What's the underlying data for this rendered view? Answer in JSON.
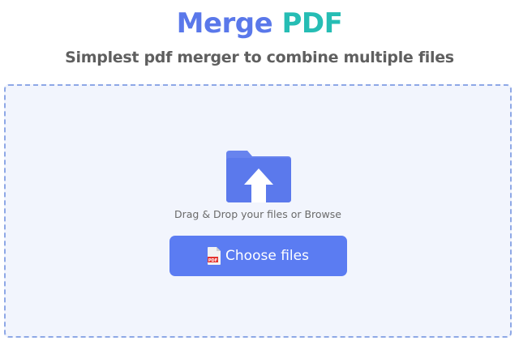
{
  "header": {
    "title_part1": "Merge",
    "title_part2": "PDF",
    "subtitle": "Simplest pdf merger to combine multiple files"
  },
  "dropzone": {
    "icon": "folder-upload-icon",
    "hint": "Drag & Drop your files or Browse",
    "button_label": "Choose files",
    "button_icon": "pdf-file-icon",
    "pdf_icon_text": "PDF"
  },
  "colors": {
    "title_primary": "#5a78ea",
    "title_accent": "#26bdb4",
    "button": "#5b7cf2",
    "dropzone_bg": "#f2f5fd",
    "dropzone_border": "#8ea8e6"
  }
}
